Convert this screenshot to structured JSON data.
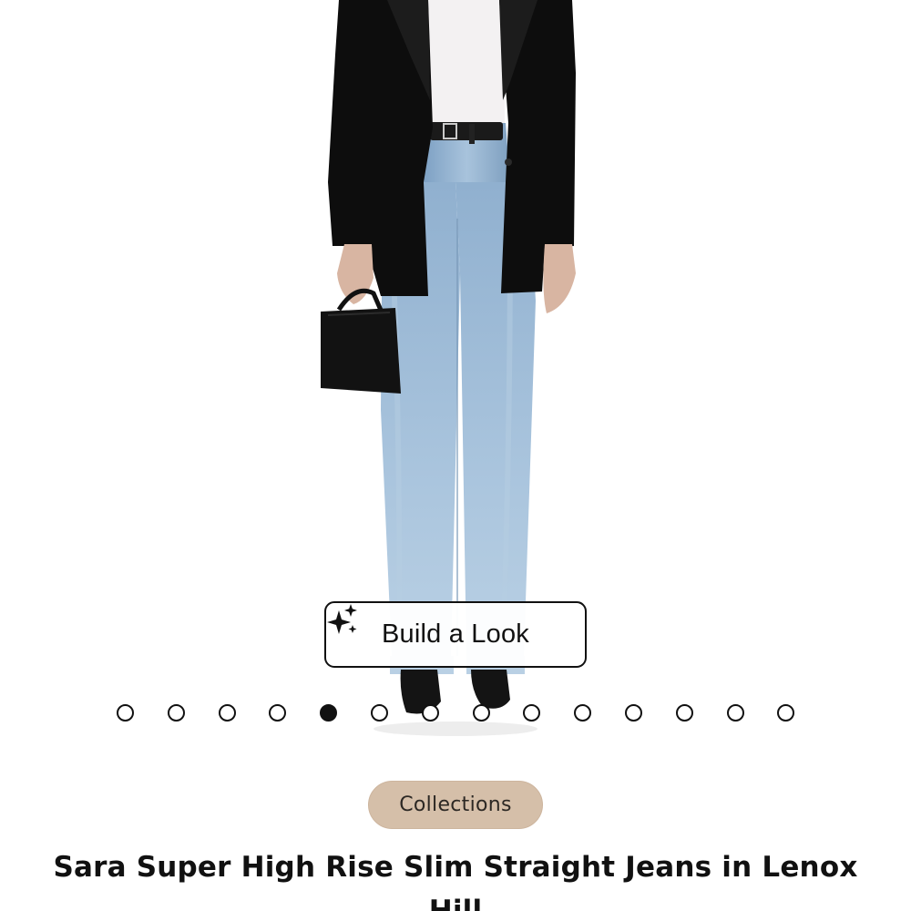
{
  "product_gallery": {
    "image_alt": "Model wearing Sara Super High Rise Slim Straight Jeans with black blazer and black handbag",
    "build_look_label": "Build a Look",
    "build_look_icon": "sparkles-icon",
    "pagination": {
      "total": 14,
      "active_index": 4
    }
  },
  "collection_badge": {
    "label": "Collections",
    "color": "#d5bfa9"
  },
  "product": {
    "title": "Sara Super High Rise Slim Straight Jeans in Lenox Hill"
  },
  "colors": {
    "text": "#111111",
    "denim": "#8fb0cf",
    "blazer": "#0d0d0d"
  }
}
